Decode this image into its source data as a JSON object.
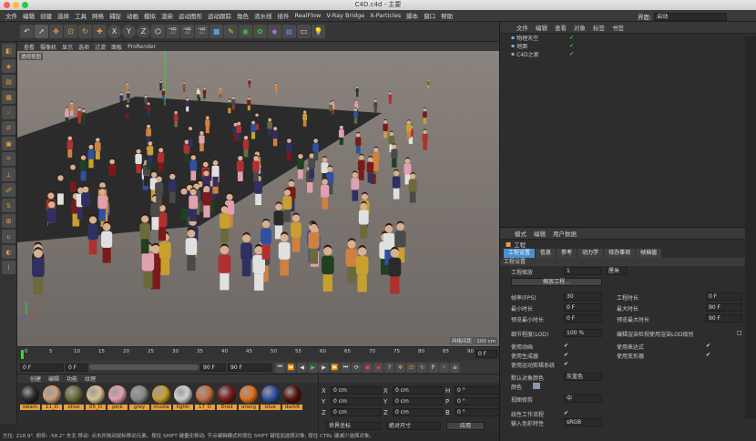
{
  "window": {
    "title": "C4D.c4d - 主要"
  },
  "menubar": {
    "items": [
      "文件",
      "编辑",
      "创建",
      "选择",
      "工具",
      "网格",
      "捕捉",
      "动画",
      "模拟",
      "渲染",
      "运动图形",
      "运动跟踪",
      "角色",
      "流水线",
      "插件",
      "RealFlow",
      "V-Ray Bridge",
      "X-Particles",
      "脚本",
      "窗口",
      "帮助"
    ],
    "layout_label": "界面:",
    "layout_value": "启动"
  },
  "toolbar": {
    "axis_x": "X",
    "axis_y": "Y",
    "axis_z": "Z"
  },
  "viewport": {
    "menu": [
      "查看",
      "摄像机",
      "显示",
      "选项",
      "过滤",
      "面板",
      "ProRender"
    ],
    "camera_label": "透视视图",
    "grid_info": "网格间距 : 100 cm"
  },
  "timeline": {
    "ticks": [
      "0",
      "5",
      "10",
      "15",
      "20",
      "25",
      "30",
      "35",
      "40",
      "45",
      "50",
      "55",
      "60",
      "65",
      "70",
      "75",
      "80",
      "85",
      "90"
    ],
    "frame_field": "0 F"
  },
  "transport": {
    "start": "0 F",
    "start2": "0 F",
    "end": "90 F",
    "end2": "90 F"
  },
  "materials": {
    "menu": [
      "创建",
      "编辑",
      "功能",
      "纹理"
    ],
    "swatches": [
      {
        "label": "swam",
        "color": "#2a2a2a"
      },
      {
        "label": "11_D",
        "color": "#c9a07a"
      },
      {
        "label": "olive",
        "color": "#6a6a3a"
      },
      {
        "label": "05_D",
        "color": "#d8c090"
      },
      {
        "label": "pink",
        "color": "#e0a0b0"
      },
      {
        "label": "grey",
        "color": "#8a8a8a"
      },
      {
        "label": "musta",
        "color": "#c8a030"
      },
      {
        "label": "lightr",
        "color": "#d0d0d0"
      },
      {
        "label": "17_D",
        "color": "#c07040"
      },
      {
        "label": "Dred",
        "color": "#7a1a1a"
      },
      {
        "label": "orang",
        "color": "#e07020"
      },
      {
        "label": "blue",
        "color": "#3050a0"
      },
      {
        "label": "darkR",
        "color": "#5a1010"
      }
    ]
  },
  "coords": {
    "x_pos": "0 cm",
    "y_pos": "0 cm",
    "z_pos": "0 cm",
    "x_size": "0 cm",
    "y_size": "0 cm",
    "z_size": "0 cm",
    "h": "0 °",
    "p": "0 °",
    "b": "0 °",
    "mode_left": "世界坐标",
    "mode_right": "绝对尺寸",
    "apply": "应用"
  },
  "objects": {
    "menu": [
      "文件",
      "编辑",
      "查看",
      "对象",
      "标签",
      "书签"
    ],
    "rows": [
      "物理天空",
      "地面",
      "C4D之家"
    ]
  },
  "attributes": {
    "menu": [
      "模式",
      "编辑",
      "用户数据"
    ],
    "title": "工程",
    "tabs": [
      "工程设置",
      "信息",
      "参考",
      "动力学",
      "待办事项",
      "帧插值"
    ],
    "section": "工程设置",
    "scale_label": "工程缩放",
    "scale_value": "1",
    "scale_unit": "厘米",
    "scale_btn": "缩放工程...",
    "fps_label": "帧率(FPS)",
    "fps_value": "30",
    "duration_label": "工程时长",
    "duration_value": "0 F",
    "min_label": "最小时长",
    "min_value": "0 F",
    "max_label": "最大时长",
    "max_value": "90 F",
    "pmin_label": "预览最小时长",
    "pmin_value": "0 F",
    "pmax_label": "预览最大时长",
    "pmax_value": "90 F",
    "lod_label": "细节程度(LOD)",
    "lod_value": "100 %",
    "lod_check_label": "编辑渲染检视使用渲染LOD级别",
    "use_anim": "使用动画",
    "use_expr": "使用表达式",
    "use_gen": "使用生成器",
    "use_deform": "使用变形器",
    "use_motion": "使用运动剪辑系统",
    "default_color_label": "默认对象颜色",
    "default_color_value": "灰蓝色",
    "color_label": "颜色",
    "view_clip_label": "视图修剪",
    "view_clip_value": "中",
    "linear_label": "线性工作流程",
    "input_color_label": "输入色彩特性",
    "input_color_value": "sRGB"
  },
  "status": {
    "text": "方位: 218.9°, 俯仰: -58.2° 东北 移动: 点击并拖动鼠标移动元素。按住 SHIFT 键量化移动; 节点编辑模式时按住 SHIFT 键增加选择对象; 按住 CTRL 键减少选择对象。"
  },
  "colors": {
    "accent": "#e8a040",
    "viewport_bg": "#7b746f",
    "floor": "#2b2b2b"
  }
}
